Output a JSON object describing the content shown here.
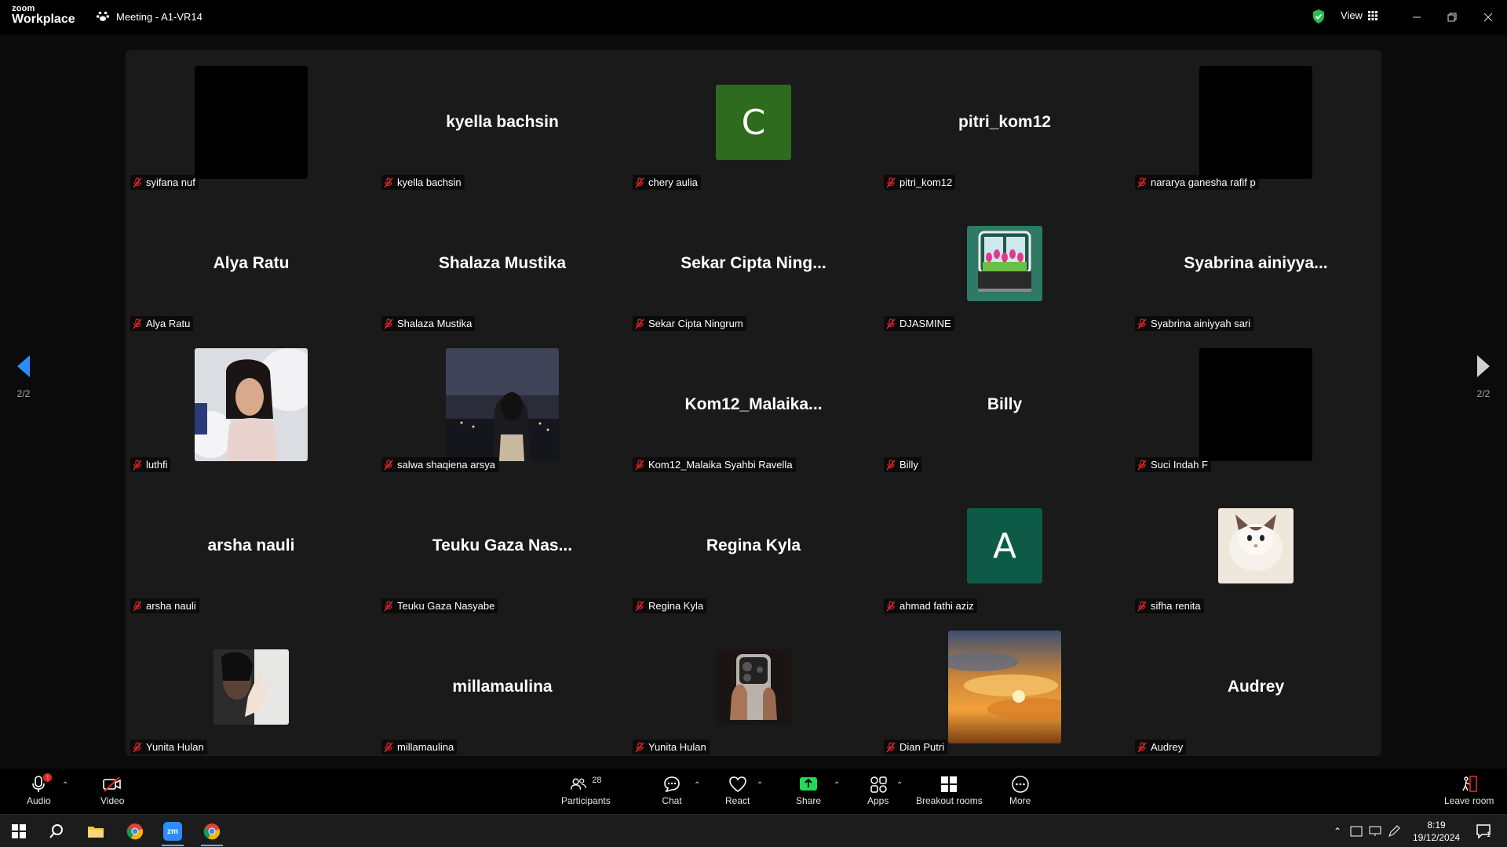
{
  "titlebar": {
    "logo_top": "zoom",
    "logo_bottom": "Workplace",
    "meeting_title": "Meeting - A1-VR14",
    "view_label": "View"
  },
  "pagination": {
    "left_label": "2/2",
    "right_label": "2/2"
  },
  "participants": [
    {
      "label": "syifana nuf",
      "display": "",
      "avatar": "black"
    },
    {
      "label": "kyella bachsin",
      "display": "kyella bachsin",
      "avatar": "none"
    },
    {
      "label": "chery aulia",
      "display": "",
      "avatar": "letter",
      "letter": "C",
      "color": "#2f6b1f"
    },
    {
      "label": "pitri_kom12",
      "display": "pitri_kom12",
      "avatar": "none"
    },
    {
      "label": "nararya ganesha rafif p",
      "display": "",
      "avatar": "black"
    },
    {
      "label": "Alya Ratu",
      "display": "Alya Ratu",
      "avatar": "none"
    },
    {
      "label": "Shalaza Mustika",
      "display": "Shalaza Mustika",
      "avatar": "none"
    },
    {
      "label": "Sekar Cipta Ningrum",
      "display": "Sekar Cipta Ning...",
      "avatar": "none"
    },
    {
      "label": "DJASMINE",
      "display": "",
      "avatar": "window-flowers"
    },
    {
      "label": "Syabrina ainiyyah sari",
      "display": "Syabrina  ainiyya...",
      "avatar": "none"
    },
    {
      "label": "luthfi",
      "display": "",
      "avatar": "photo-light"
    },
    {
      "label": "salwa shaqiena arsya",
      "display": "",
      "avatar": "photo-night"
    },
    {
      "label": "Kom12_Malaika Syahbi Ravella",
      "display": "Kom12_Malaika...",
      "avatar": "none"
    },
    {
      "label": "Billy",
      "display": "Billy",
      "avatar": "none"
    },
    {
      "label": "Suci Indah F",
      "display": "",
      "avatar": "black"
    },
    {
      "label": "arsha nauli",
      "display": "arsha nauli",
      "avatar": "none"
    },
    {
      "label": "Teuku Gaza Nasyabe",
      "display": "Teuku Gaza Nas...",
      "avatar": "none"
    },
    {
      "label": "Regina Kyla",
      "display": "Regina Kyla",
      "avatar": "none"
    },
    {
      "label": "ahmad fathi aziz",
      "display": "",
      "avatar": "letter",
      "letter": "A",
      "color": "#0d5a47"
    },
    {
      "label": "sifha renita",
      "display": "",
      "avatar": "photo-cat"
    },
    {
      "label": "Yunita Hulan",
      "display": "",
      "avatar": "photo-hand"
    },
    {
      "label": "millamaulina",
      "display": "millamaulina",
      "avatar": "none"
    },
    {
      "label": "Yunita Hulan",
      "display": "",
      "avatar": "photo-phone"
    },
    {
      "label": "Dian Putri",
      "display": "",
      "avatar": "photo-sunset"
    },
    {
      "label": "Audrey",
      "display": "Audrey",
      "avatar": "none"
    }
  ],
  "toolbar": {
    "audio": "Audio",
    "video": "Video",
    "participants": "Participants",
    "participants_count": "28",
    "chat": "Chat",
    "react": "React",
    "share": "Share",
    "apps": "Apps",
    "breakout": "Breakout rooms",
    "more": "More",
    "leave": "Leave room"
  },
  "taskbar": {
    "time": "8:19",
    "date": "19/12/2024",
    "notifications": "1"
  },
  "colors": {
    "accent_blue": "#2d8cff",
    "share_green": "#23d959",
    "mute_red": "#e02828",
    "leave_red": "#e02828"
  }
}
